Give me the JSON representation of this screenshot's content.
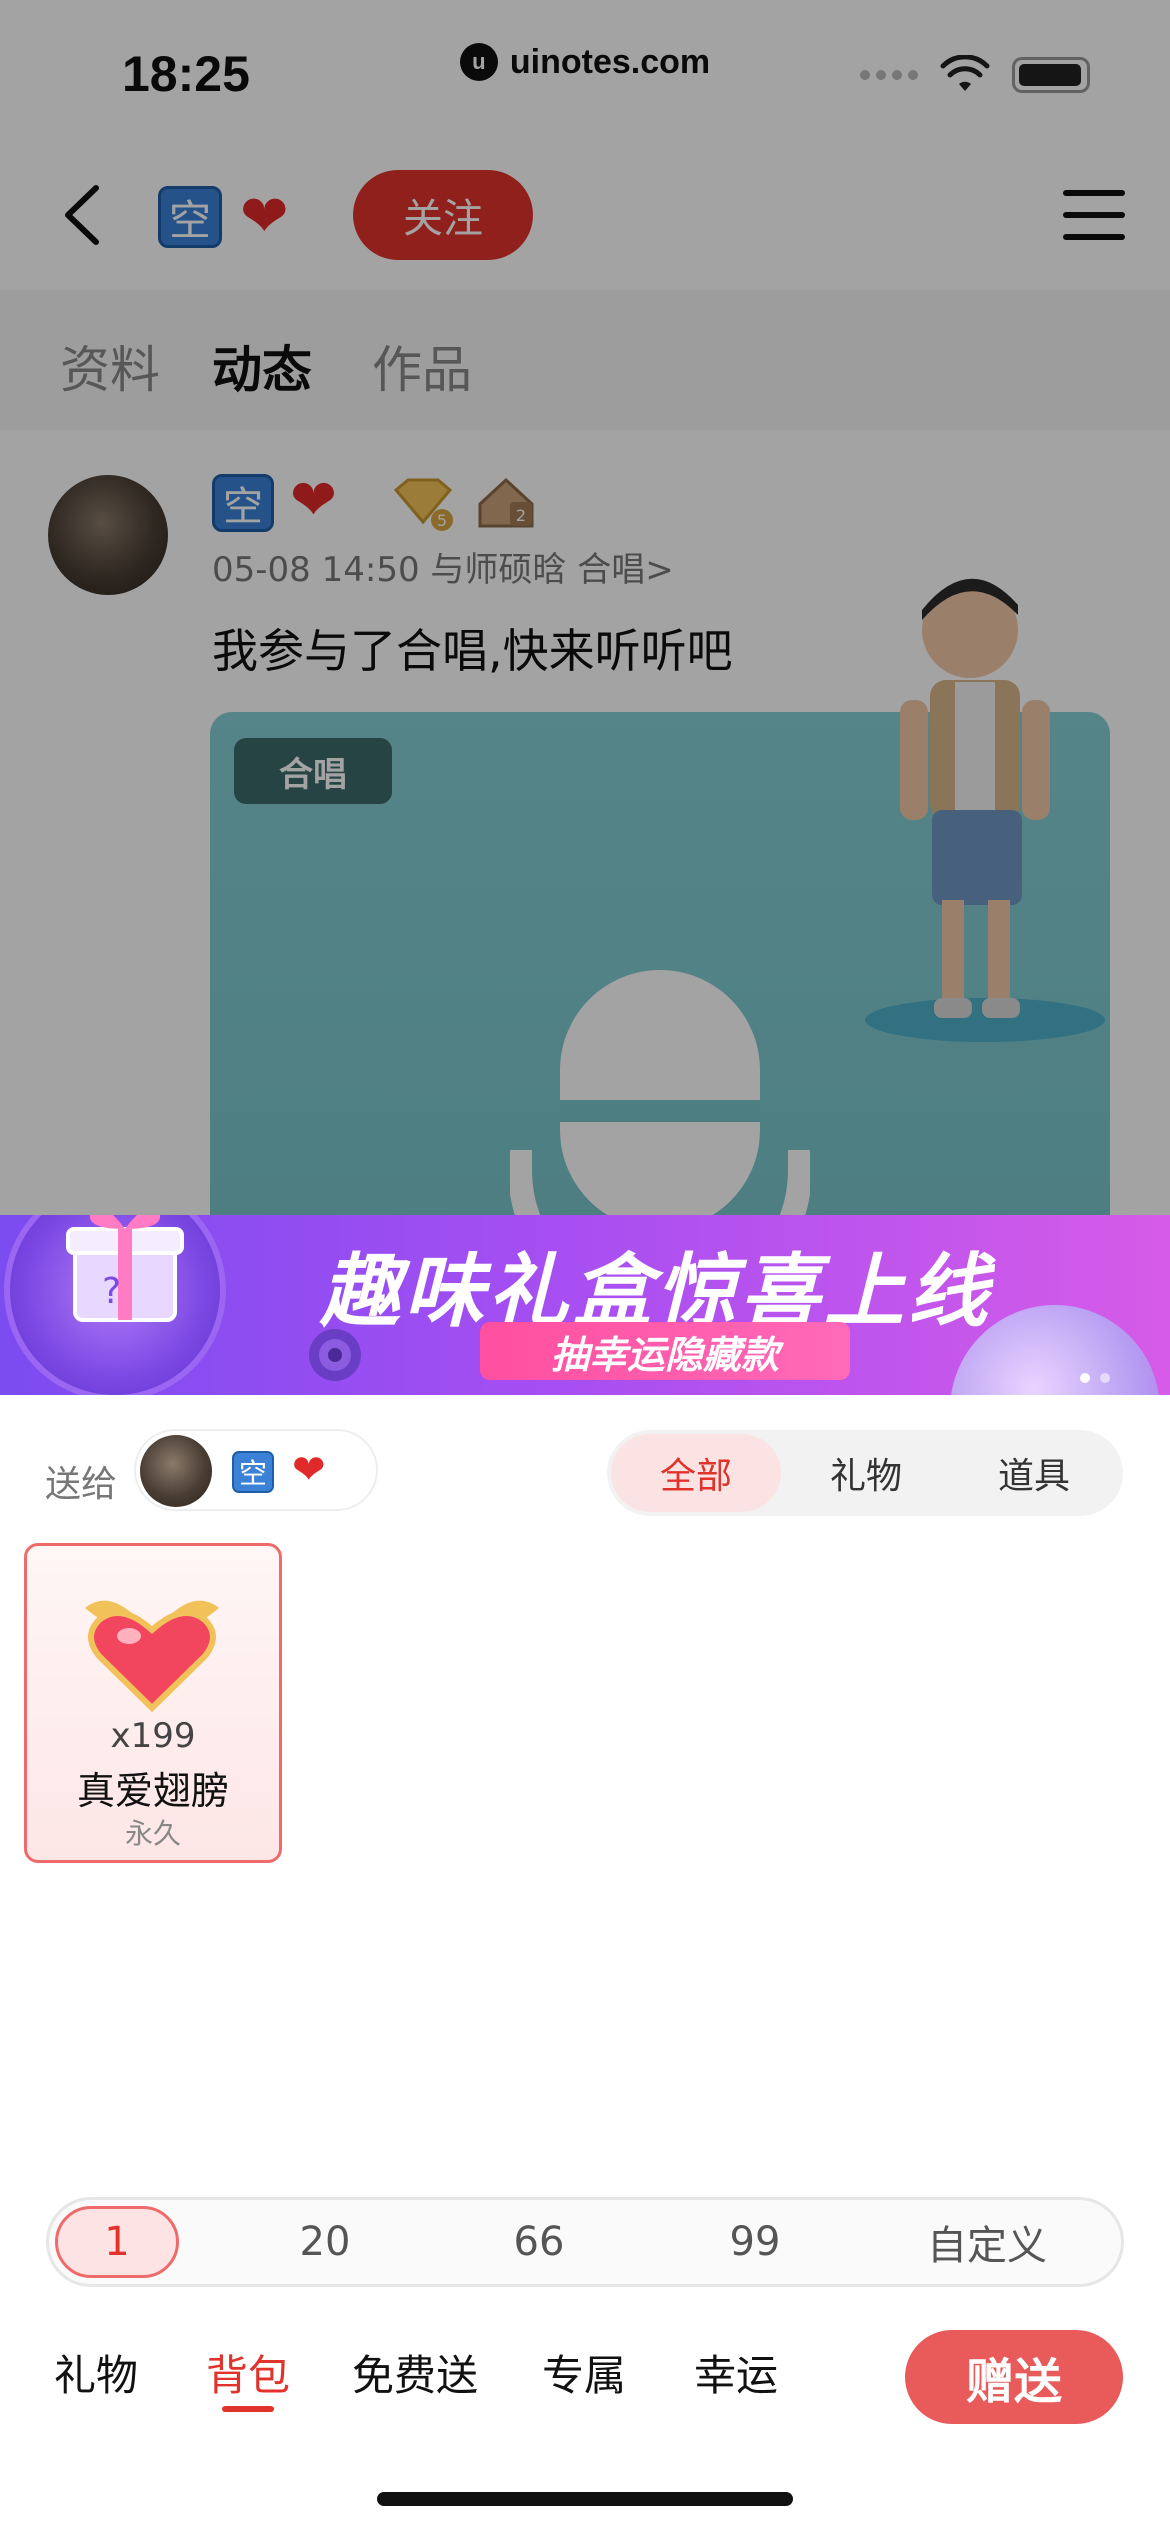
{
  "status_bar": {
    "time": "18:25",
    "url": "uinotes.com"
  },
  "nav": {
    "user_badge": "空",
    "follow_label": "关注"
  },
  "profile_tabs": [
    "资料",
    "动态",
    "作品"
  ],
  "post": {
    "badge": "空",
    "level_gem": "5",
    "level_house": "2",
    "meta": "05-08 14:50 与师硕晗 合唱>",
    "text": "我参与了合唱,快来听听吧",
    "media_tag": "合唱"
  },
  "banner": {
    "title": "趣味礼盒惊喜上线",
    "subtitle": "抽幸运隐藏款"
  },
  "sheet": {
    "send_to_label": "送给",
    "recipient_badge": "空",
    "filter_tabs": [
      "全部",
      "礼物",
      "道具"
    ],
    "gift": {
      "count": "x199",
      "name": "真爱翅膀",
      "expiry": "永久"
    },
    "quantities": [
      "1",
      "20",
      "66",
      "99",
      "自定义"
    ],
    "bottom_tabs": [
      "礼物",
      "背包",
      "免费送",
      "专属",
      "幸运"
    ],
    "send_label": "赠送"
  },
  "colors": {
    "accent_red": "#e0332c",
    "banner_purple": "#7b4cf0"
  }
}
